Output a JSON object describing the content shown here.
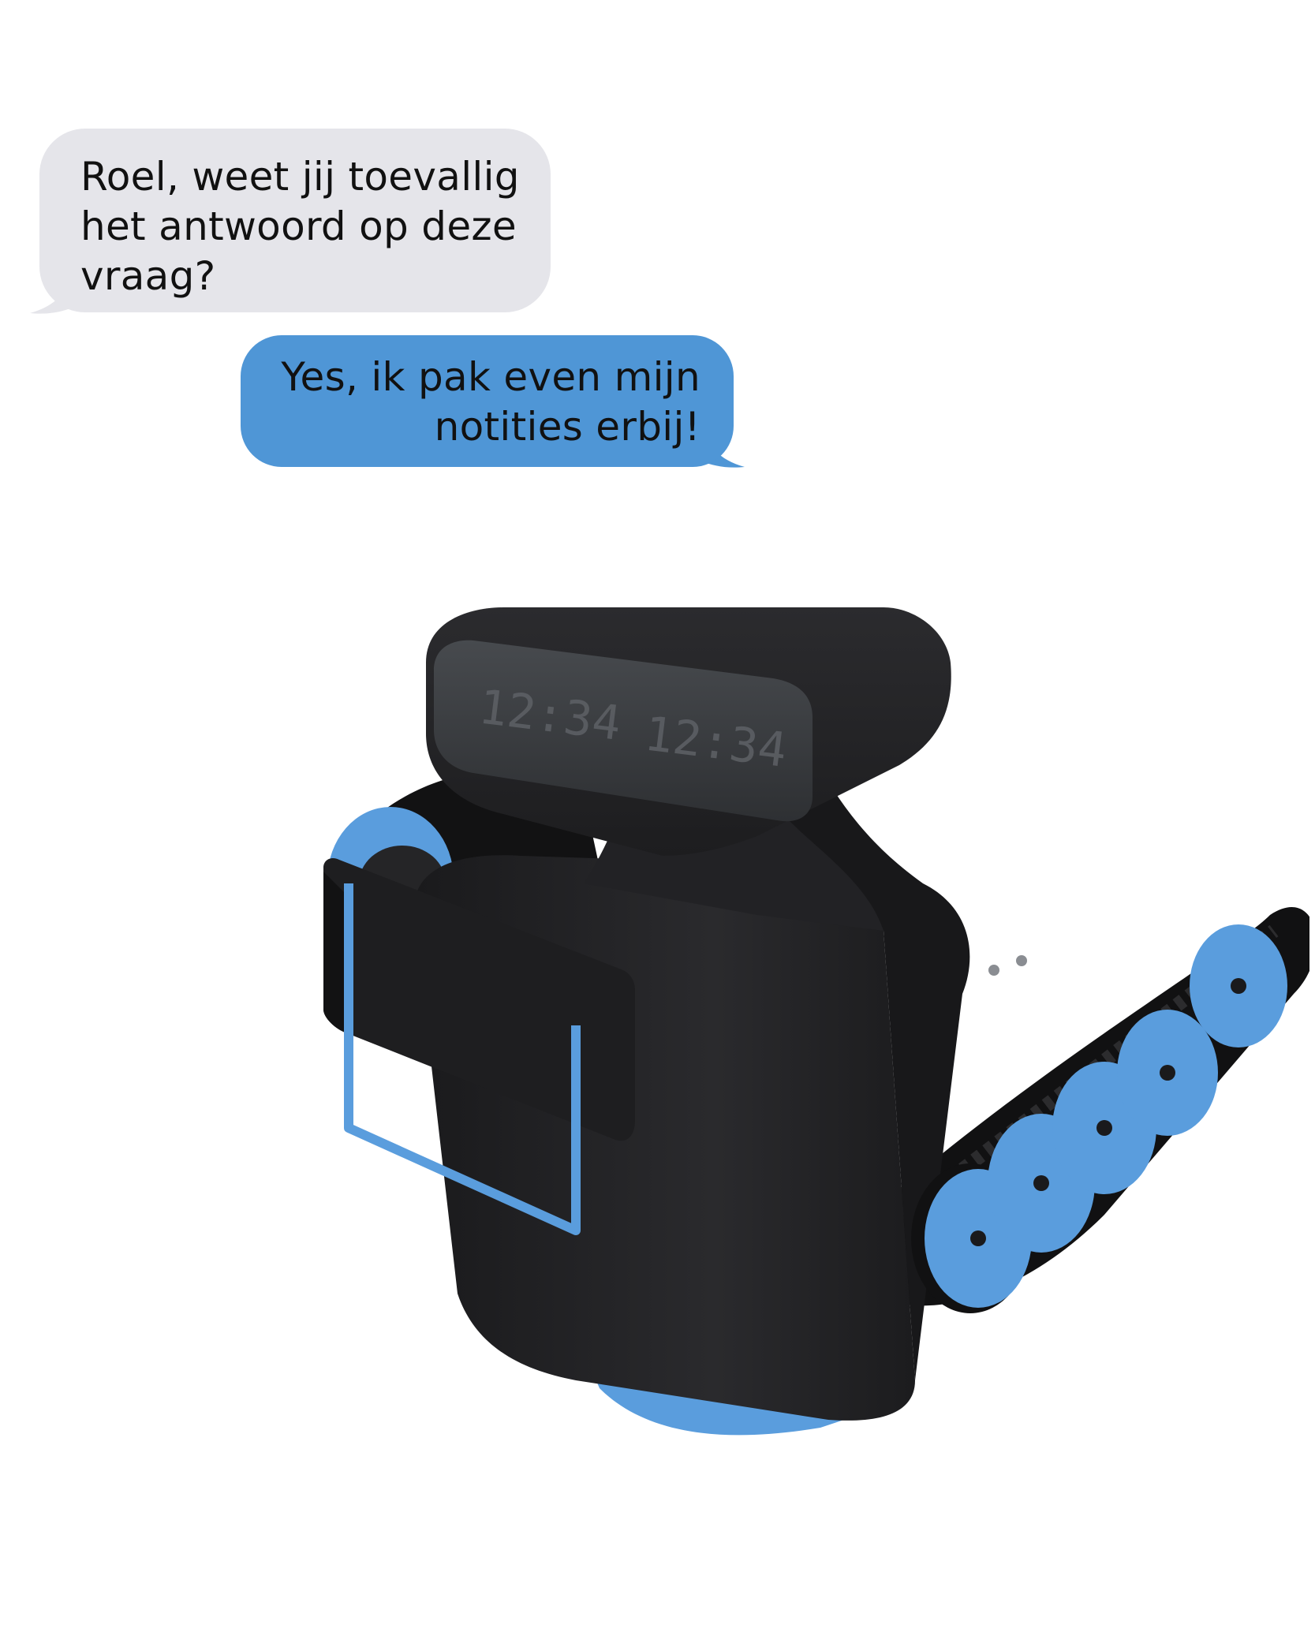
{
  "conversation": {
    "messages": [
      {
        "direction": "received",
        "lines": [
          "Roel, weet jij toevallig",
          "het antwoord op deze",
          "vraag?"
        ]
      },
      {
        "direction": "sent",
        "lines": [
          "Yes, ik pak even mijn",
          "notities erbij!"
        ]
      }
    ],
    "colors": {
      "received_bubble": "#e5e5ea",
      "sent_bubble": "#4f96d6",
      "text": "#111111"
    }
  },
  "robot": {
    "display_readouts": [
      "12:34",
      "12:34"
    ],
    "colors": {
      "body": "#202022",
      "accent": "#5a9ddd",
      "screen": "#3a3d40"
    }
  }
}
